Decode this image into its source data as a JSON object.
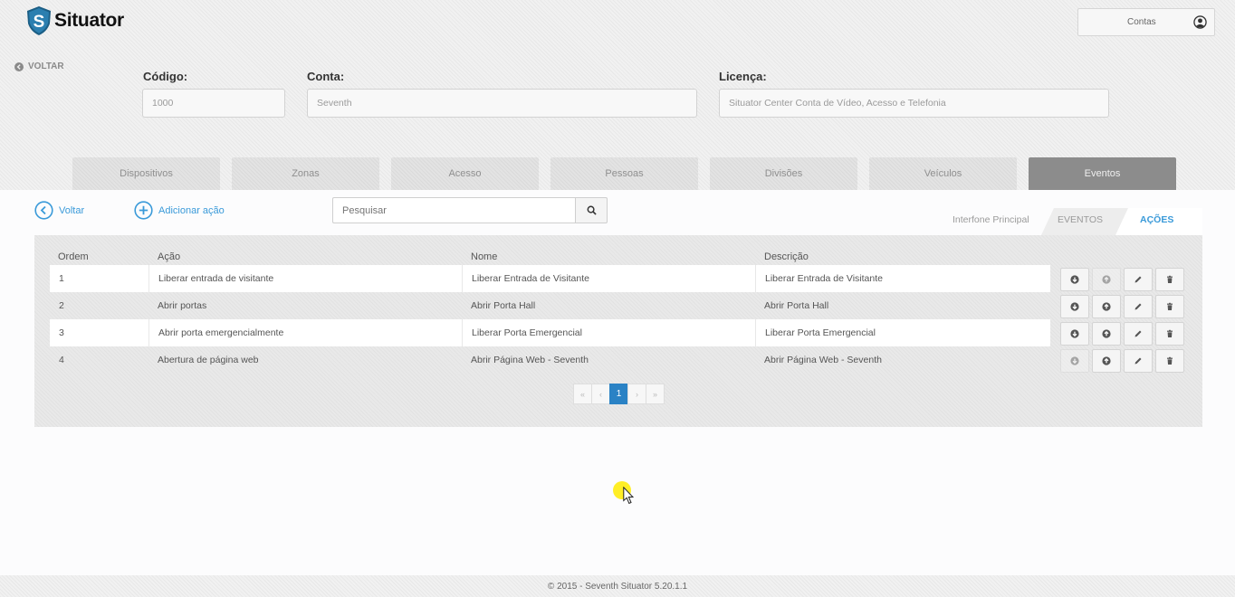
{
  "app": {
    "name": "Situator",
    "account_label": "Contas",
    "back_label": "VOLTAR"
  },
  "fields": {
    "codigo": {
      "label": "Código:",
      "value": "1000"
    },
    "conta": {
      "label": "Conta:",
      "value": "Seventh"
    },
    "licenca": {
      "label": "Licença:",
      "value": "Situator Center Conta de Vídeo, Acesso e Telefonia"
    }
  },
  "tabs": [
    "Dispositivos",
    "Zonas",
    "Acesso",
    "Pessoas",
    "Divisões",
    "Veículos",
    "Eventos"
  ],
  "active_tab": "Eventos",
  "toolbar": {
    "back_label": "Voltar",
    "add_label": "Adicionar ação",
    "search_placeholder": "Pesquisar"
  },
  "breadcrumb": {
    "context": "Interfone Principal",
    "eventos": "EVENTOS",
    "acoes": "AÇÕES"
  },
  "table": {
    "headers": [
      "Ordem",
      "Ação",
      "Nome",
      "Descrição"
    ],
    "rows": [
      {
        "ordem": "1",
        "acao": "Liberar entrada de visitante",
        "nome": "Liberar Entrada de Visitante",
        "descricao": "Liberar Entrada de Visitante"
      },
      {
        "ordem": "2",
        "acao": "Abrir portas",
        "nome": "Abrir Porta Hall",
        "descricao": "Abrir Porta Hall"
      },
      {
        "ordem": "3",
        "acao": "Abrir porta emergencialmente",
        "nome": "Liberar Porta Emergencial",
        "descricao": "Liberar Porta Emergencial"
      },
      {
        "ordem": "4",
        "acao": "Abertura de página web",
        "nome": "Abrir Página Web - Seventh",
        "descricao": "Abrir Página Web - Seventh"
      }
    ]
  },
  "pagination": {
    "first": "«",
    "prev": "‹",
    "current": "1",
    "next": "›",
    "last": "»"
  },
  "footer": "© 2015 - Seventh Situator 5.20.1.1",
  "colors": {
    "accent": "#3a9ad9",
    "active_tab": "#8c8c8c",
    "pager_current": "#2a82c5",
    "logo_shield": "#1b5e85"
  }
}
